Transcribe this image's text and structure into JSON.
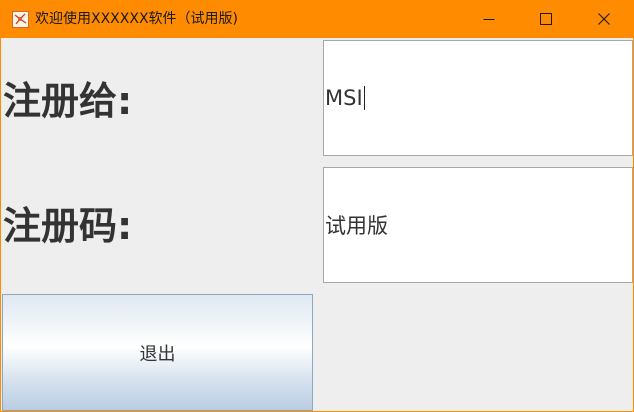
{
  "window": {
    "title": "欢迎使用XXXXXX软件（试用版)",
    "title_bar_color": "#ff8c00",
    "app_icon": "java-app-icon",
    "controls": [
      "minimize-icon",
      "maximize-icon",
      "close-icon"
    ]
  },
  "form": {
    "registered_to_label": "注册给:",
    "registered_to_value": "MSI",
    "registration_code_label": "注册码:",
    "registration_code_value": "试用版"
  },
  "actions": {
    "exit_label": "退出"
  }
}
